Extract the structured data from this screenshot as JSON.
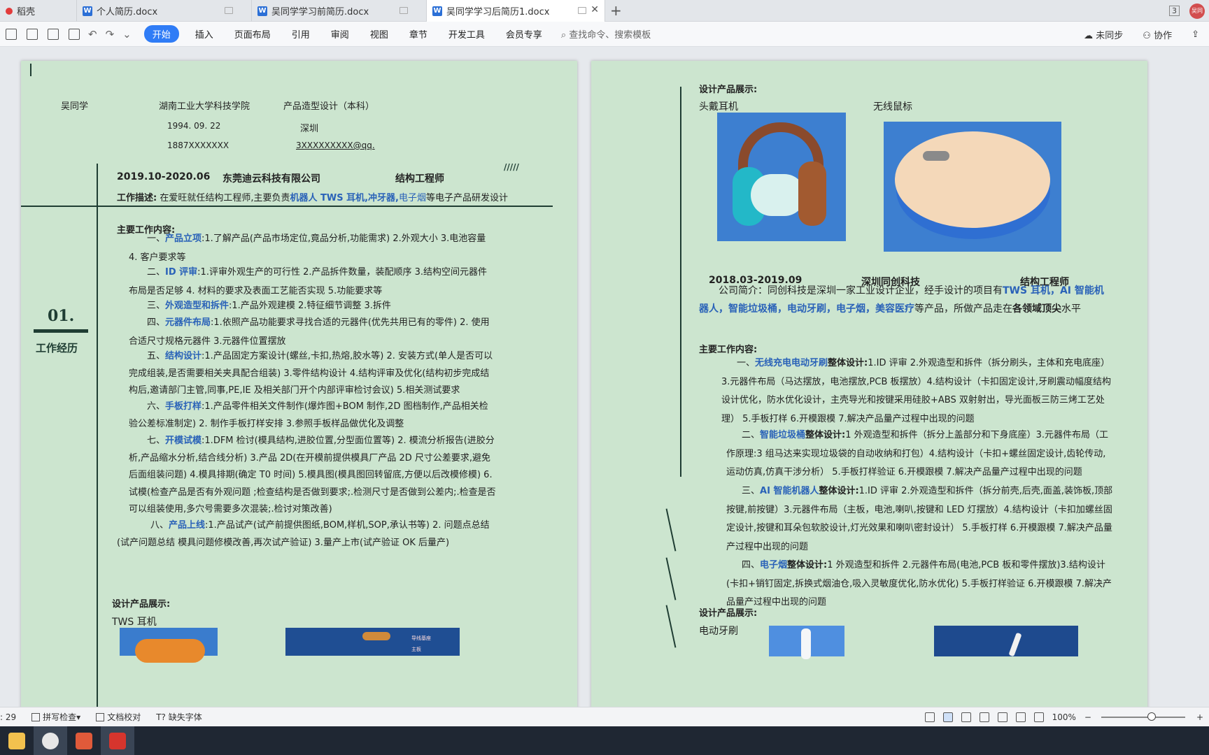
{
  "tabs": [
    {
      "label": "稻壳",
      "active": false
    },
    {
      "label": "个人简历.docx",
      "active": false
    },
    {
      "label": "吴同学学习前简历.docx",
      "active": false
    },
    {
      "label": "吴同学学习后简历1.docx",
      "active": true
    }
  ],
  "tabbar_right": {
    "page_count": "3",
    "avatar_text": "吴同"
  },
  "menu": {
    "items": [
      "开始",
      "插入",
      "页面布局",
      "引用",
      "审阅",
      "视图",
      "章节",
      "开发工具",
      "会员专享"
    ],
    "search_placeholder": "查找命令、搜索模板",
    "right": {
      "sync": "未同步",
      "collab": "协作"
    }
  },
  "left_page": {
    "header": {
      "name": "吴同学",
      "school": "湖南工业大学科技学院",
      "major": "产品造型设计（本科）",
      "birth": "1994. 09. 22",
      "city": "深圳",
      "phone": "1887XXXXXXX",
      "email": "3XXXXXXXXX@qq."
    },
    "section": {
      "number": "01.",
      "title": "工作经历"
    },
    "job": {
      "period": "2019.10-2020.06",
      "company": "东莞迪云科技有限公司",
      "role": "结构工程师",
      "desc_label": "工作描述:",
      "desc_pre": "在爱旺就任结构工程师,主要负责",
      "desc_hl": "机器人 TWS 耳机,冲牙器,",
      "desc_hl2": "电子烟",
      "desc_post": "等电子产品研发设计"
    },
    "work_title": "主要工作内容:",
    "items": [
      {
        "prefix": "一、",
        "title": "产品立项",
        "text": ":1.了解产品(产品市场定位,竟品分析,功能需求) 2.外观大小  3.电池容量   4. 客户要求等"
      },
      {
        "prefix": "二、",
        "title": "ID 评审",
        "text": ":1.评审外观生产的可行性 2.产品拆件数量，装配顺序 3.结构空间元器件布局是否足够   4. 材料的要求及表面工艺能否实现  5.功能要求等"
      },
      {
        "prefix": "三、",
        "title": "外观造型和拆件",
        "text": ":1.产品外观建模 2.特征细节调整 3.拆件"
      },
      {
        "prefix": "四、",
        "title": "元器件布局",
        "text": ":1.依照产品功能要求寻找合适的元器件(优先共用已有的零件)   2. 使用合适尺寸规格元器件  3.元器件位置摆放"
      },
      {
        "prefix": "五、",
        "title": "结构设计",
        "text": ":1.产品固定方案设计(螺丝,卡扣,热熔,胶水等)    2. 安装方式(单人是否可以完成组装,是否需要相关夹具配合组装)    3.零件结构设计  4.结构评审及优化(结构初步完成结构后,邀请部门主管,同事,PE,IE 及相关部门开个内部评审检讨会议) 5.相关测试要求"
      },
      {
        "prefix": "六、",
        "title": "手板打样",
        "text": ":1.产品零件相关文件制作(爆炸图+BOM 制作,2D 图档制作,产品相关检验公差标准制定)   2. 制作手板打样安排  3.参照手板样品做优化及调整"
      },
      {
        "prefix": "七、",
        "title": "开模试模",
        "text": ":1.DFM 检讨(模具结构,进胶位置,分型面位置等)    2. 模流分析报告(进胶分析,产品缩水分析,结合线分析)    3.产品 2D(在开模前提供模具厂产品 2D 尺寸公差要求,避免后面组装问题)    4.模具排期(确定 T0 时间)    5.模具图(模具图回转留底,方便以后改模修模)    6.试模(检查产品是否有外观问题  ;检查结构是否做到要求;.检测尺寸是否做到公差内;.检查是否可以组装使用,多穴号需要多次混装;.检讨对策改善)"
      },
      {
        "prefix": "八、",
        "title": "产品上线",
        "text": ":1.产品试产(试产前提供图纸,BOM,样机,SOP,承认书等)    2. 问题点总结(试产问题总结  模具问题修模改善,再次试产验证)    3.量产上市(试产验证 OK 后量产)"
      }
    ],
    "design_title": "设计产品展示:",
    "design_item": "TWS 耳机",
    "callouts": [
      "导线基座",
      "主板"
    ]
  },
  "right_page": {
    "design_title": "设计产品展示:",
    "products": [
      "头戴耳机",
      "无线鼠标"
    ],
    "job": {
      "period": "2018.03-2019.09",
      "company": "深圳同创科技",
      "role": "结构工程师",
      "intro_pre": "公司简介：同创科技是深圳一家工业设计企业，经手设计的项目有",
      "intro_hl": "TWS 耳机，AI 智能机器人，智能垃圾桶，电动牙刷，电子烟，美容医疗",
      "intro_mid": "等产品，所做产品走在",
      "intro_bold": "各领域顶尖",
      "intro_post": "水平"
    },
    "work_title": "主要工作内容:",
    "items": [
      {
        "prefix": "一、",
        "title": "无线充电电动牙刷",
        "sub": "整体设计:",
        "text": "1.ID 评审 2.外观造型和拆件（拆分刷头，主体和充电底座）3.元器件布局（马达摆放，电池摆放,PCB 板摆放）4.结构设计（卡扣固定设计,牙刷震动幅度结构设计优化，防水优化设计，主壳导光和按键采用硅胶+ABS 双射射出，导光面板三防三烤工艺处理）  5.手板打样  6.开模跟模  7.解决产品量产过程中出现的问题"
      },
      {
        "prefix": "二、",
        "title": "智能垃圾桶",
        "sub": "整体设计:",
        "text": "1 外观造型和拆件（拆分上盖部分和下身底座）3.元器件布局（工作原理:3 组马达来实现垃圾袋的自动收纳和打包）4.结构设计（卡扣+螺丝固定设计,齿轮传动,运动仿真,仿真干涉分析）  5.手板打样验证  6.开模跟模  7.解决产品量产过程中出现的问题"
      },
      {
        "prefix": "三、",
        "title": "AI 智能机器人",
        "sub": "整体设计:",
        "text": "1.ID 评审 2.外观造型和拆件（拆分前壳,后壳,面盖,装饰板,顶部按键,前按键）3.元器件布局（主板，电池,喇叭,按键和 LED 灯摆放）4.结构设计（卡扣加螺丝固定设计,按键和耳朵包软胶设计,灯光效果和喇叭密封设计）  5.手板打样  6.开模跟模  7.解决产品量产过程中出现的问题"
      },
      {
        "prefix": "四、",
        "title": "电子烟",
        "sub": "整体设计:",
        "text": "1 外观造型和拆件 2.元器件布局(电池,PCB 板和零件摆放)3.结构设计(卡扣+销钉固定,拆换式烟油仓,吸入灵敏度优化,防水优化) 5.手板打样验证    6.开模跟模 7.解决产品量产过程中出现的问题"
      }
    ],
    "design_title2": "设计产品展示:",
    "design_item2": "电动牙刷"
  },
  "statusbar": {
    "page_info": ": 29",
    "spell": "拼写检查",
    "proof": "文档校对",
    "missing_font": "缺失字体",
    "zoom": "100%"
  }
}
